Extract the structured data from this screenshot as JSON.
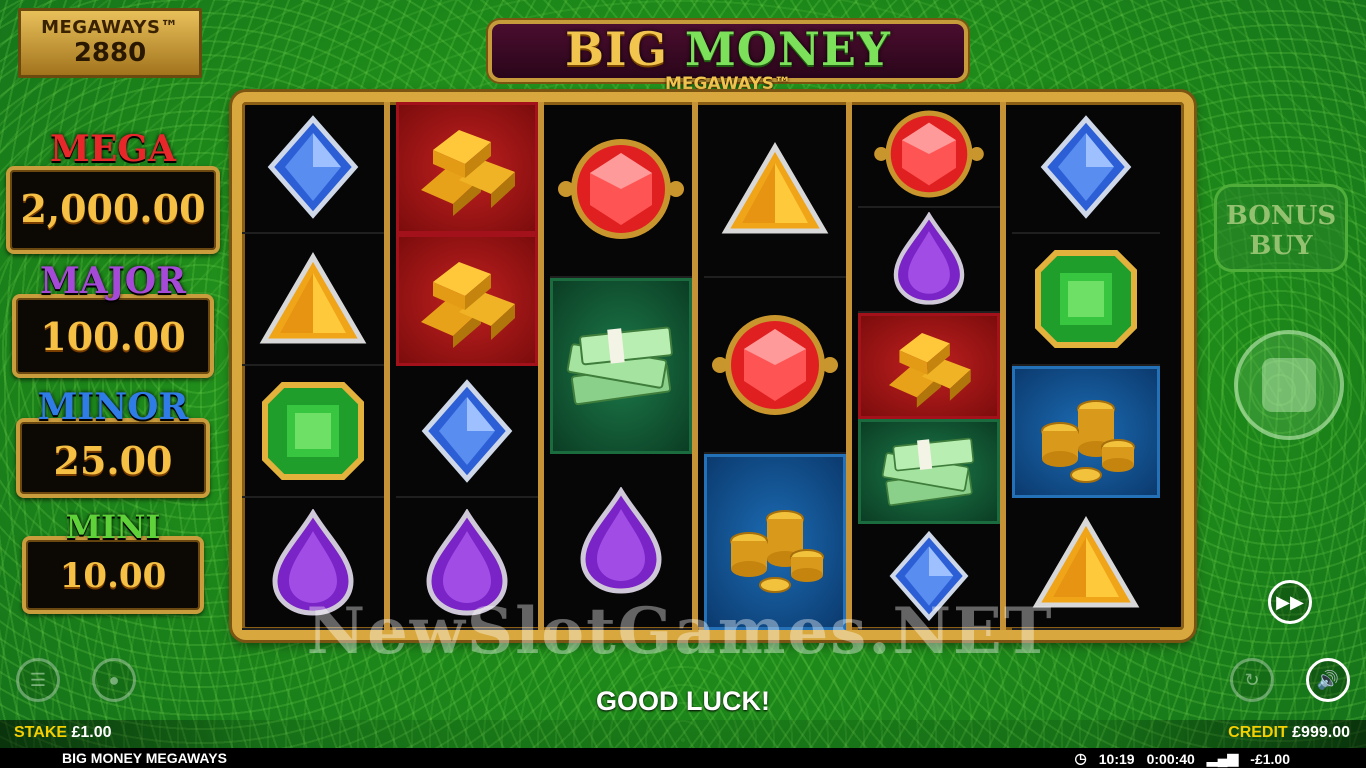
{
  "megaways": {
    "label": "MEGAWAYS™",
    "count": "2880"
  },
  "logo": {
    "word1": "BIG",
    "word2": "MONEY",
    "subtitle": "MEGAWAYS™"
  },
  "jackpots": [
    {
      "name": "MEGA",
      "value": "2,000.00",
      "color": "#e8272a"
    },
    {
      "name": "MAJOR",
      "value": "100.00",
      "color": "#a54ad6"
    },
    {
      "name": "MINOR",
      "value": "25.00",
      "color": "#2f7ce6"
    },
    {
      "name": "MINI",
      "value": "10.00",
      "color": "#5fd23a"
    }
  ],
  "reels": [
    [
      "blue-diamond-gem",
      "orange-triangle-gem",
      "green-emerald-gem",
      "purple-drop-gem"
    ],
    [
      "gold-bars",
      "gold-bars",
      "blue-diamond-gem",
      "purple-drop-gem"
    ],
    [
      "red-ruby-gem",
      "cash-stack",
      "purple-drop-gem"
    ],
    [
      "orange-triangle-gem",
      "red-ruby-gem",
      "gold-coins"
    ],
    [
      "red-ruby-gem",
      "purple-drop-gem",
      "gold-bars",
      "cash-stack",
      "blue-diamond-gem"
    ],
    [
      "blue-diamond-gem",
      "green-emerald-gem",
      "gold-coins",
      "orange-triangle-gem"
    ]
  ],
  "bonus_buy": {
    "line1": "BONUS",
    "line2": "BUY"
  },
  "watermark": "NewSlotGames.NET",
  "message": "GOOD LUCK!",
  "stake": {
    "label": "STAKE",
    "value": "£1.00"
  },
  "credit": {
    "label": "CREDIT",
    "value": "£999.00"
  },
  "footer": {
    "game_name": "BIG MONEY MEGAWAYS",
    "clock": "10:19",
    "session_time": "0:00:40",
    "net": "-£1.00"
  },
  "colors": {
    "background_green": "#2a9b22",
    "frame_gold": "#d8a83e",
    "stake_label": "#f5d000"
  }
}
